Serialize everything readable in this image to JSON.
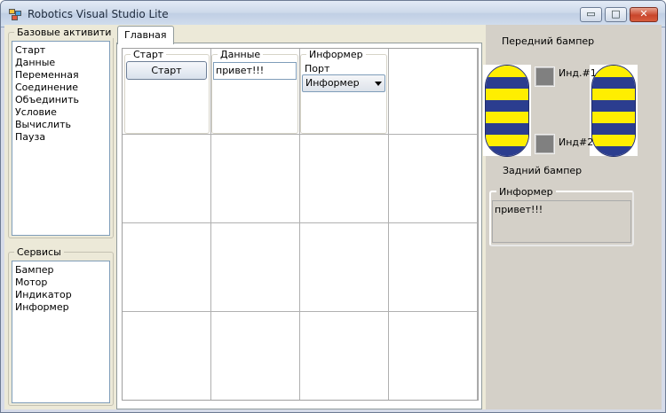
{
  "window": {
    "title": "Robotics Visual Studio Lite",
    "controls": {
      "minimize": "▭",
      "maximize": "□",
      "close": "✕"
    }
  },
  "left": {
    "activities": {
      "title": "Базовые активити",
      "items": [
        "Старт",
        "Данные",
        "Переменная",
        "Соединение",
        "Объединить",
        "Условие",
        "Вычислить",
        "Пауза"
      ]
    },
    "services": {
      "title": "Сервисы",
      "items": [
        "Бампер",
        "Мотор",
        "Индикатор",
        "Информер"
      ]
    }
  },
  "tabs": [
    {
      "label": "Главная",
      "active": true
    }
  ],
  "canvas": {
    "start_block": {
      "title": "Старт",
      "button_label": "Старт"
    },
    "data_block": {
      "title": "Данные",
      "value": "привет!!!"
    },
    "informer_block": {
      "title": "Информер",
      "port_label": "Порт",
      "port_value": "Информер"
    }
  },
  "right": {
    "front_bumper_label": "Передний бампер",
    "rear_bumper_label": "Задний бампер",
    "indicator1_label": "Инд.#1",
    "indicator2_label": "Инд#2",
    "informer_title": "Информер",
    "informer_text": "привет!!!",
    "colors": {
      "bumper_yellow": "#ffee00",
      "bumper_blue": "#2b3d8f",
      "indicator_off": "#808080"
    }
  }
}
